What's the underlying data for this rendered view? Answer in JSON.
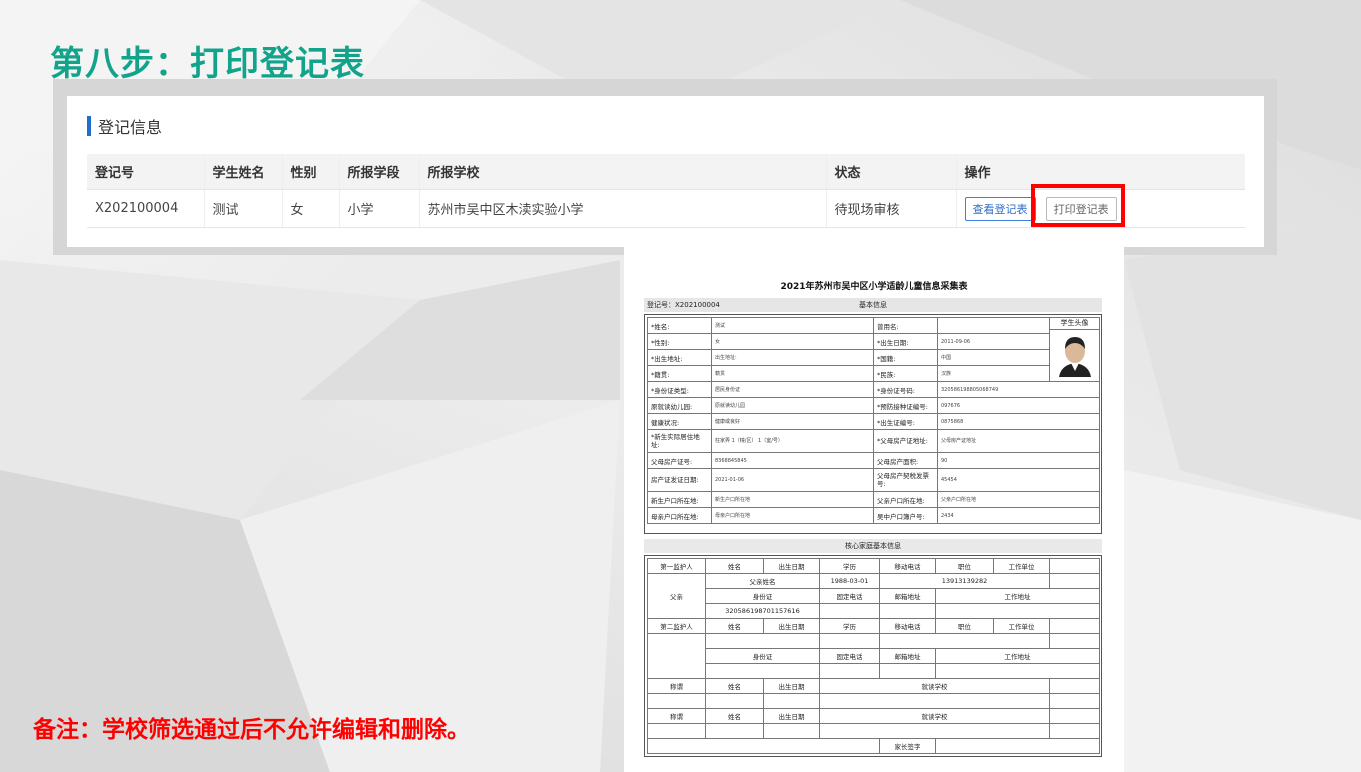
{
  "slide": {
    "title": "第八步：打印登记表",
    "note": "备注：学校筛选通过后不允许编辑和删除。"
  },
  "panel": {
    "section_title": "登记信息",
    "columns": [
      "登记号",
      "学生姓名",
      "性别",
      "所报学段",
      "所报学校",
      "状态",
      "操作"
    ],
    "row": {
      "reg_no": "X202100004",
      "name": "测试",
      "gender": "女",
      "stage": "小学",
      "school": "苏州市吴中区木渎实验小学",
      "status": "待现场审核",
      "view_label": "查看登记表",
      "print_label": "打印登记表"
    }
  },
  "form": {
    "title": "2021年苏州市吴中区小学适龄儿童信息采集表",
    "reg_no": "登记号：X202100004",
    "basic_title": "基本信息",
    "photo_label": "学生头像",
    "rows": [
      {
        "l1": "*姓名:",
        "v1": "测试",
        "l2": "曾用名:",
        "v2": ""
      },
      {
        "l1": "*性别:",
        "v1": "女",
        "l2": "*出生日期:",
        "v2": "2011-09-06"
      },
      {
        "l1": "*出生地址:",
        "v1": "出生地址:",
        "l2": "*国籍:",
        "v2": "中国"
      },
      {
        "l1": "*籍贯:",
        "v1": "籍贯",
        "l2": "*民族:",
        "v2": "汉族"
      },
      {
        "l1": "*身份证类型:",
        "v1": "居民身份证",
        "l2": "*身份证号码:",
        "v2": "320586198805068749"
      },
      {
        "l1": "原就读幼儿园:",
        "v1": "原就读幼儿园",
        "l2": "*预防接种证编号:",
        "v2": "097676"
      },
      {
        "l1": "健康状况:",
        "v1": "健康或良好",
        "l2": "*出生证编号:",
        "v2": "0875868"
      },
      {
        "l1": "*新生实际居住地址:",
        "v1": "枉家弄 1（幢/区） 1（室/号）",
        "l2": "*父母房产证地址:",
        "v2": "父母房产证地址"
      },
      {
        "l1": "父母房产证号:",
        "v1": "8368845845",
        "l2": "父母房产面积:",
        "v2": "90"
      },
      {
        "l1": "房产证发证日期:",
        "v1": "2021-01-06",
        "l2": "父母房产契税发票号:",
        "v2": "45454"
      },
      {
        "l1": "新生户口所在地:",
        "v1": "新生户口所在地",
        "l2": "父亲户口所在地:",
        "v2": "父亲户口所在地"
      },
      {
        "l1": "母亲户口所在地:",
        "v1": "母亲户口所在地",
        "l2": "吴中户口簿户号:",
        "v2": "2434"
      }
    ],
    "family_title": "核心家庭基本信息",
    "g1_header": [
      "第一监护人",
      "姓名",
      "出生日期",
      "学历",
      "移动电话",
      "职位",
      "工作单位"
    ],
    "father": {
      "label": "父亲",
      "name": "父亲姓名",
      "birth": "1988-03-01",
      "phone": "13913139282",
      "sub_header": [
        "身份证",
        "固定电话",
        "邮箱地址",
        "工作地址"
      ],
      "id": "320586198701157616"
    },
    "g2_header": [
      "第二监护人",
      "姓名",
      "出生日期",
      "学历",
      "移动电话",
      "职位",
      "工作单位"
    ],
    "g2_sub_header": [
      "身份证",
      "固定电话",
      "邮箱地址",
      "工作地址"
    ],
    "sib_header": [
      "称谓",
      "姓名",
      "出生日期",
      "就读学校"
    ],
    "signature_label": "家长签字"
  }
}
